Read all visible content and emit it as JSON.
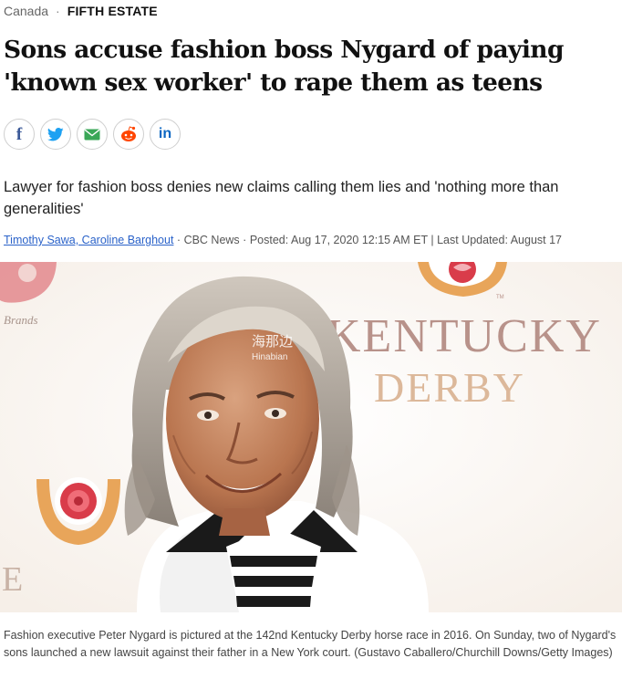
{
  "breadcrumb": {
    "category": "Canada",
    "section": "FIFTH ESTATE"
  },
  "article": {
    "headline": "Sons accuse fashion boss Nygard of paying 'known sex worker' to rape them as teens",
    "deck": "Lawyer for fashion boss denies new claims calling them lies and 'nothing more than generalities'",
    "byline": {
      "authors": "Timothy Sawa, Caroline Barghout",
      "outlet": "CBC News",
      "posted": "Posted: Aug 17, 2020 12:15 AM ET",
      "updated": "Last Updated: August 17"
    },
    "caption": "Fashion executive Peter Nygard is pictured at the 142nd Kentucky Derby horse race in 2016. On Sunday, two of Nygard's sons launched a new lawsuit against their father in a New York court. (Gustavo Caballero/Churchill Downs/Getty Images)"
  },
  "share": {
    "buttons": [
      {
        "icon": "facebook-icon",
        "glyph": "f"
      },
      {
        "icon": "twitter-icon",
        "glyph": ""
      },
      {
        "icon": "email-icon",
        "glyph": ""
      },
      {
        "icon": "reddit-icon",
        "glyph": ""
      },
      {
        "icon": "linkedin-icon",
        "glyph": "in"
      }
    ]
  },
  "photo": {
    "backdrop_line1": "KENTUCKY",
    "backdrop_line2": "DERBY",
    "backdrop_small": "Brands",
    "watermark_cn": "海那边",
    "watermark_en": "Hinabian",
    "colors": {
      "rose_red": "#d93c4a",
      "rose_gold": "#e8a55a",
      "backdrop_text": "#b8928a"
    }
  },
  "colors": {
    "link": "#2a62c9",
    "headline": "#111111",
    "facebook": "#3b5998",
    "twitter": "#1da1f2",
    "email": "#3aa757",
    "reddit": "#ff4500",
    "linkedin": "#0a66c2"
  }
}
